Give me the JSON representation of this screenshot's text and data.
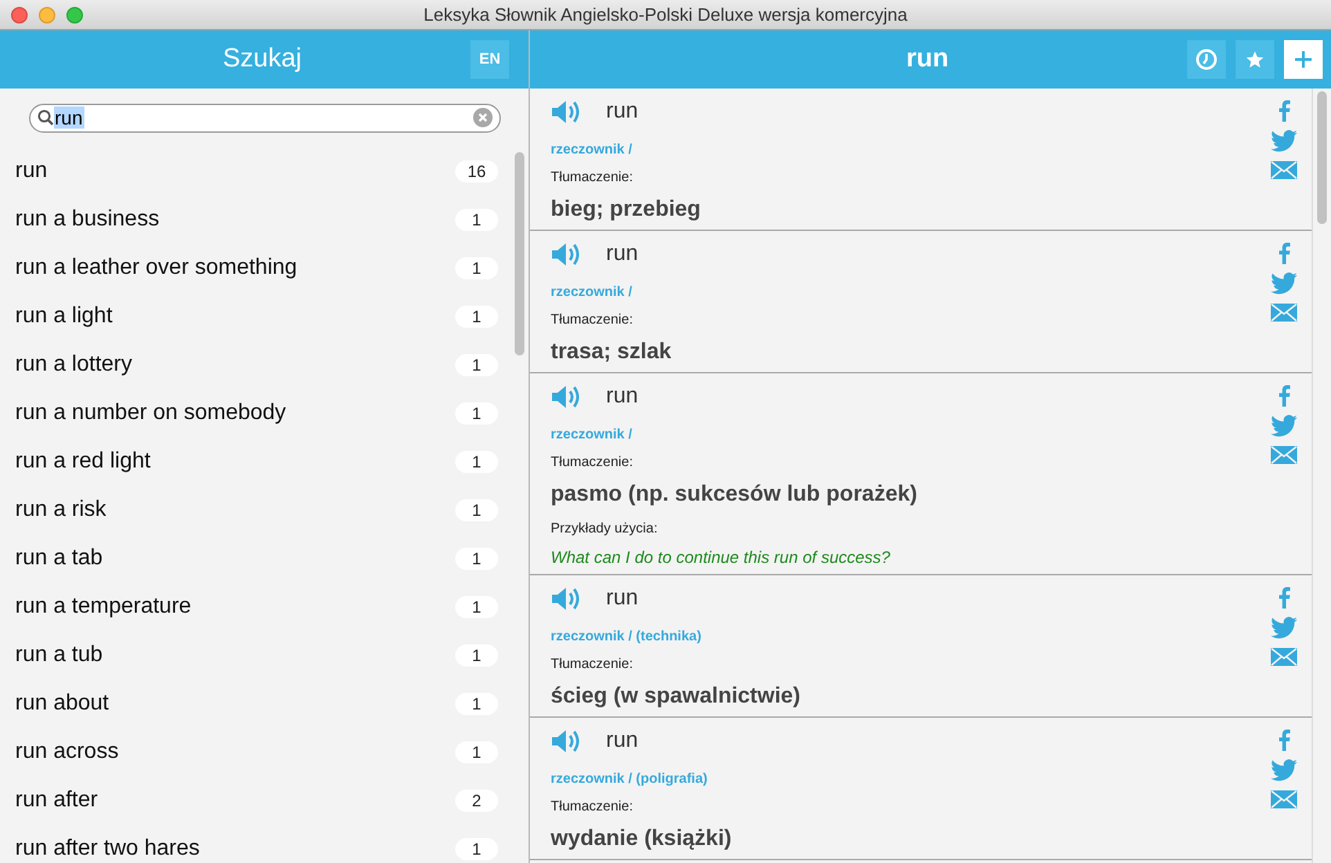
{
  "window": {
    "title": "Leksyka Słownik Angielsko-Polski Deluxe wersja komercyjna"
  },
  "left": {
    "title": "Szukaj",
    "language": "EN",
    "search": {
      "value": "run",
      "selected_text": true
    },
    "results": [
      {
        "phrase": "run",
        "count": "16"
      },
      {
        "phrase": "run a business",
        "count": "1"
      },
      {
        "phrase": "run a leather over something",
        "count": "1"
      },
      {
        "phrase": "run a light",
        "count": "1"
      },
      {
        "phrase": "run a lottery",
        "count": "1"
      },
      {
        "phrase": "run a number on somebody",
        "count": "1"
      },
      {
        "phrase": "run a red light",
        "count": "1"
      },
      {
        "phrase": "run a risk",
        "count": "1"
      },
      {
        "phrase": "run a tab",
        "count": "1"
      },
      {
        "phrase": "run a temperature",
        "count": "1"
      },
      {
        "phrase": "run a tub",
        "count": "1"
      },
      {
        "phrase": "run about",
        "count": "1"
      },
      {
        "phrase": "run across",
        "count": "1"
      },
      {
        "phrase": "run after",
        "count": "2"
      },
      {
        "phrase": "run after two hares",
        "count": "1"
      }
    ]
  },
  "right": {
    "title": "run",
    "toolbar": [
      {
        "kind": "history",
        "selected": false
      },
      {
        "kind": "favorite",
        "selected": false
      },
      {
        "kind": "add",
        "selected": true
      }
    ],
    "entries": [
      {
        "word": "run",
        "part_of_speech": "rzeczownik /",
        "translation_label": "Tłumaczenie:",
        "translation": "bieg; przebieg"
      },
      {
        "word": "run",
        "part_of_speech": "rzeczownik /",
        "translation_label": "Tłumaczenie:",
        "translation": "trasa; szlak"
      },
      {
        "word": "run",
        "part_of_speech": "rzeczownik /",
        "translation_label": "Tłumaczenie:",
        "translation": "pasmo (np. sukcesów lub porażek)",
        "examples_label": "Przykłady użycia:",
        "example": "What can I do to continue this run of success?"
      },
      {
        "word": "run",
        "part_of_speech": "rzeczownik / (technika)",
        "translation_label": "Tłumaczenie:",
        "translation": "ścieg (w spawalnictwie)"
      },
      {
        "word": "run",
        "part_of_speech": "rzeczownik / (poligrafia)",
        "translation_label": "Tłumaczenie:",
        "translation": "wydanie (książki)"
      }
    ]
  }
}
